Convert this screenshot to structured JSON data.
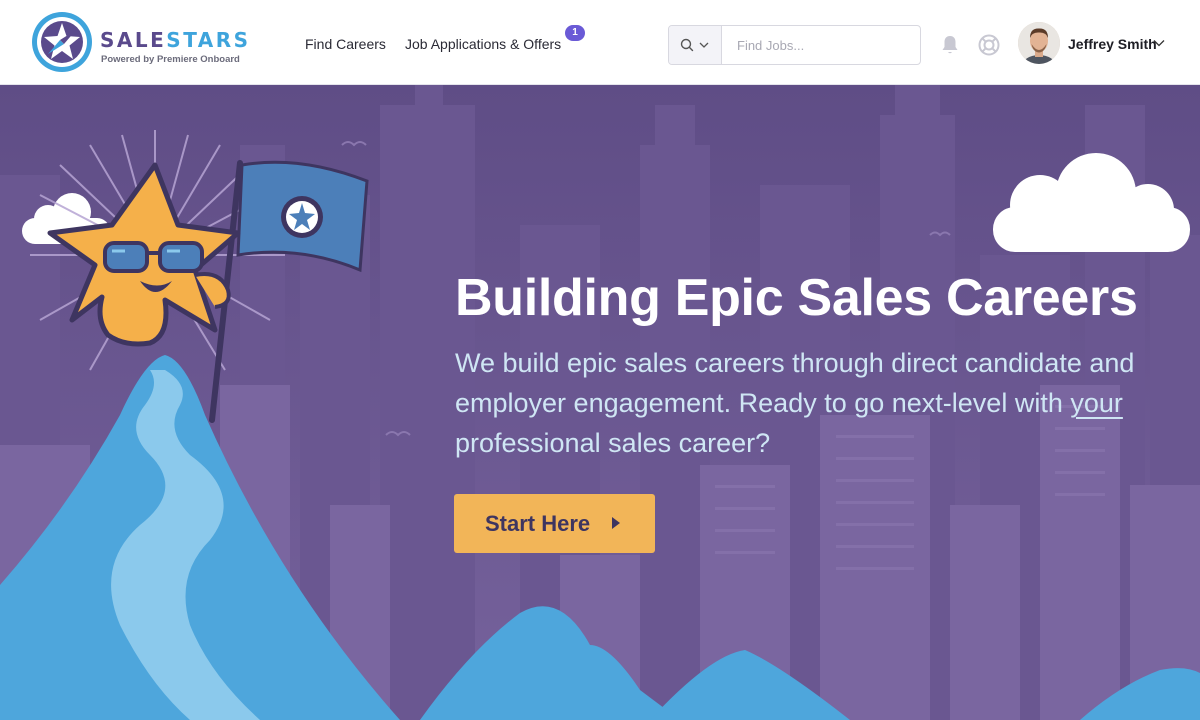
{
  "brand": {
    "word_part1": "SALE",
    "word_part2": "STARS",
    "tagline": "Powered by Premiere Onboard",
    "logo_icon": "star-compass-logo-icon",
    "colors": {
      "purple": "#5a4a8c",
      "blue": "#3ea4dc"
    }
  },
  "nav": {
    "find_careers": "Find Careers",
    "job_applications": "Job Applications & Offers",
    "applications_badge": "1"
  },
  "search": {
    "placeholder": "Find Jobs...",
    "value": "",
    "icon": "search-icon"
  },
  "header_icons": {
    "notifications": "bell-icon",
    "help": "lifebuoy-icon"
  },
  "user": {
    "name": "Jeffrey Smith",
    "caret": "chevron-down-icon"
  },
  "hero": {
    "title": "Building Epic Sales Careers",
    "text_before_link": "We build epic sales careers through direct candidate and employer engagement. Ready to go next-level with ",
    "text_underlined": "your",
    "text_after_link": " professional sales career?",
    "cta_label": "Start Here",
    "cta_icon": "caret-right-icon",
    "colors": {
      "background": "#6d5a93",
      "mountain": "#4ea6dc",
      "cta": "#f2b558",
      "mascot": "#f5b04a"
    }
  }
}
